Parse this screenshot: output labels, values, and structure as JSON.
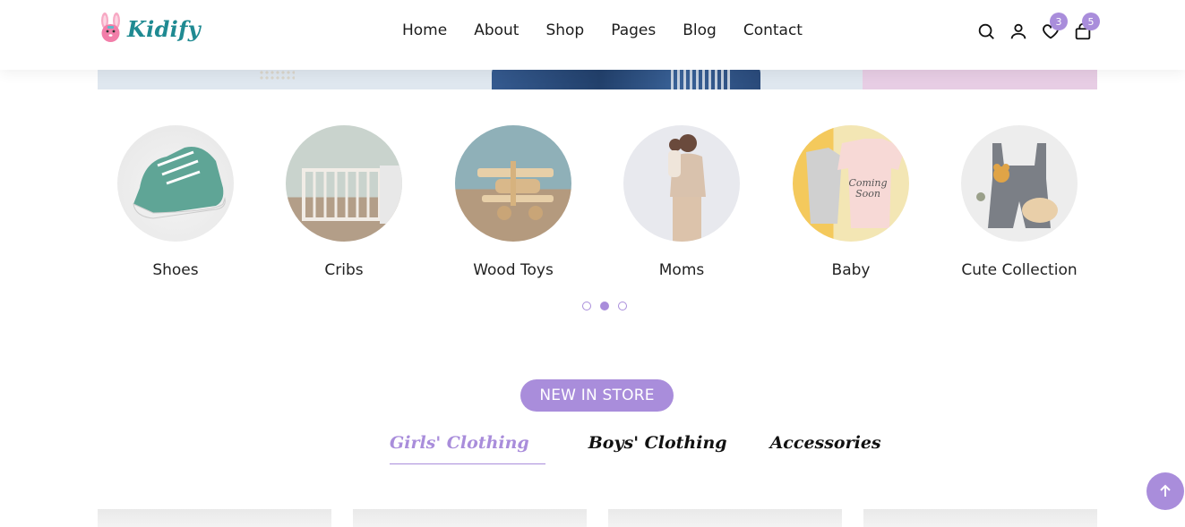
{
  "brand": {
    "name": "Kidify"
  },
  "nav": {
    "items": [
      "Home",
      "About",
      "Shop",
      "Pages",
      "Blog",
      "Contact"
    ]
  },
  "header_icons": {
    "search": "search-icon",
    "account": "user-icon",
    "wishlist": {
      "icon": "heart-icon",
      "count": "3"
    },
    "cart": {
      "icon": "bag-icon",
      "count": "5"
    }
  },
  "categories": [
    {
      "label": "Shoes"
    },
    {
      "label": "Cribs"
    },
    {
      "label": "Wood Toys"
    },
    {
      "label": "Moms"
    },
    {
      "label": "Baby"
    },
    {
      "label": "Cute Collection"
    }
  ],
  "slider": {
    "pages": 3,
    "active": 2
  },
  "new_in_store": {
    "badge": "NEW IN STORE",
    "tabs": [
      "Girls' Clothing",
      "Boys' Clothing",
      "Accessories"
    ],
    "active_tab": 0
  },
  "colors": {
    "accent": "#a98ddb",
    "brand": "#1f8a92",
    "logo_pink": "#f27ea9"
  },
  "back_to_top": {
    "icon": "arrow-up-icon"
  }
}
